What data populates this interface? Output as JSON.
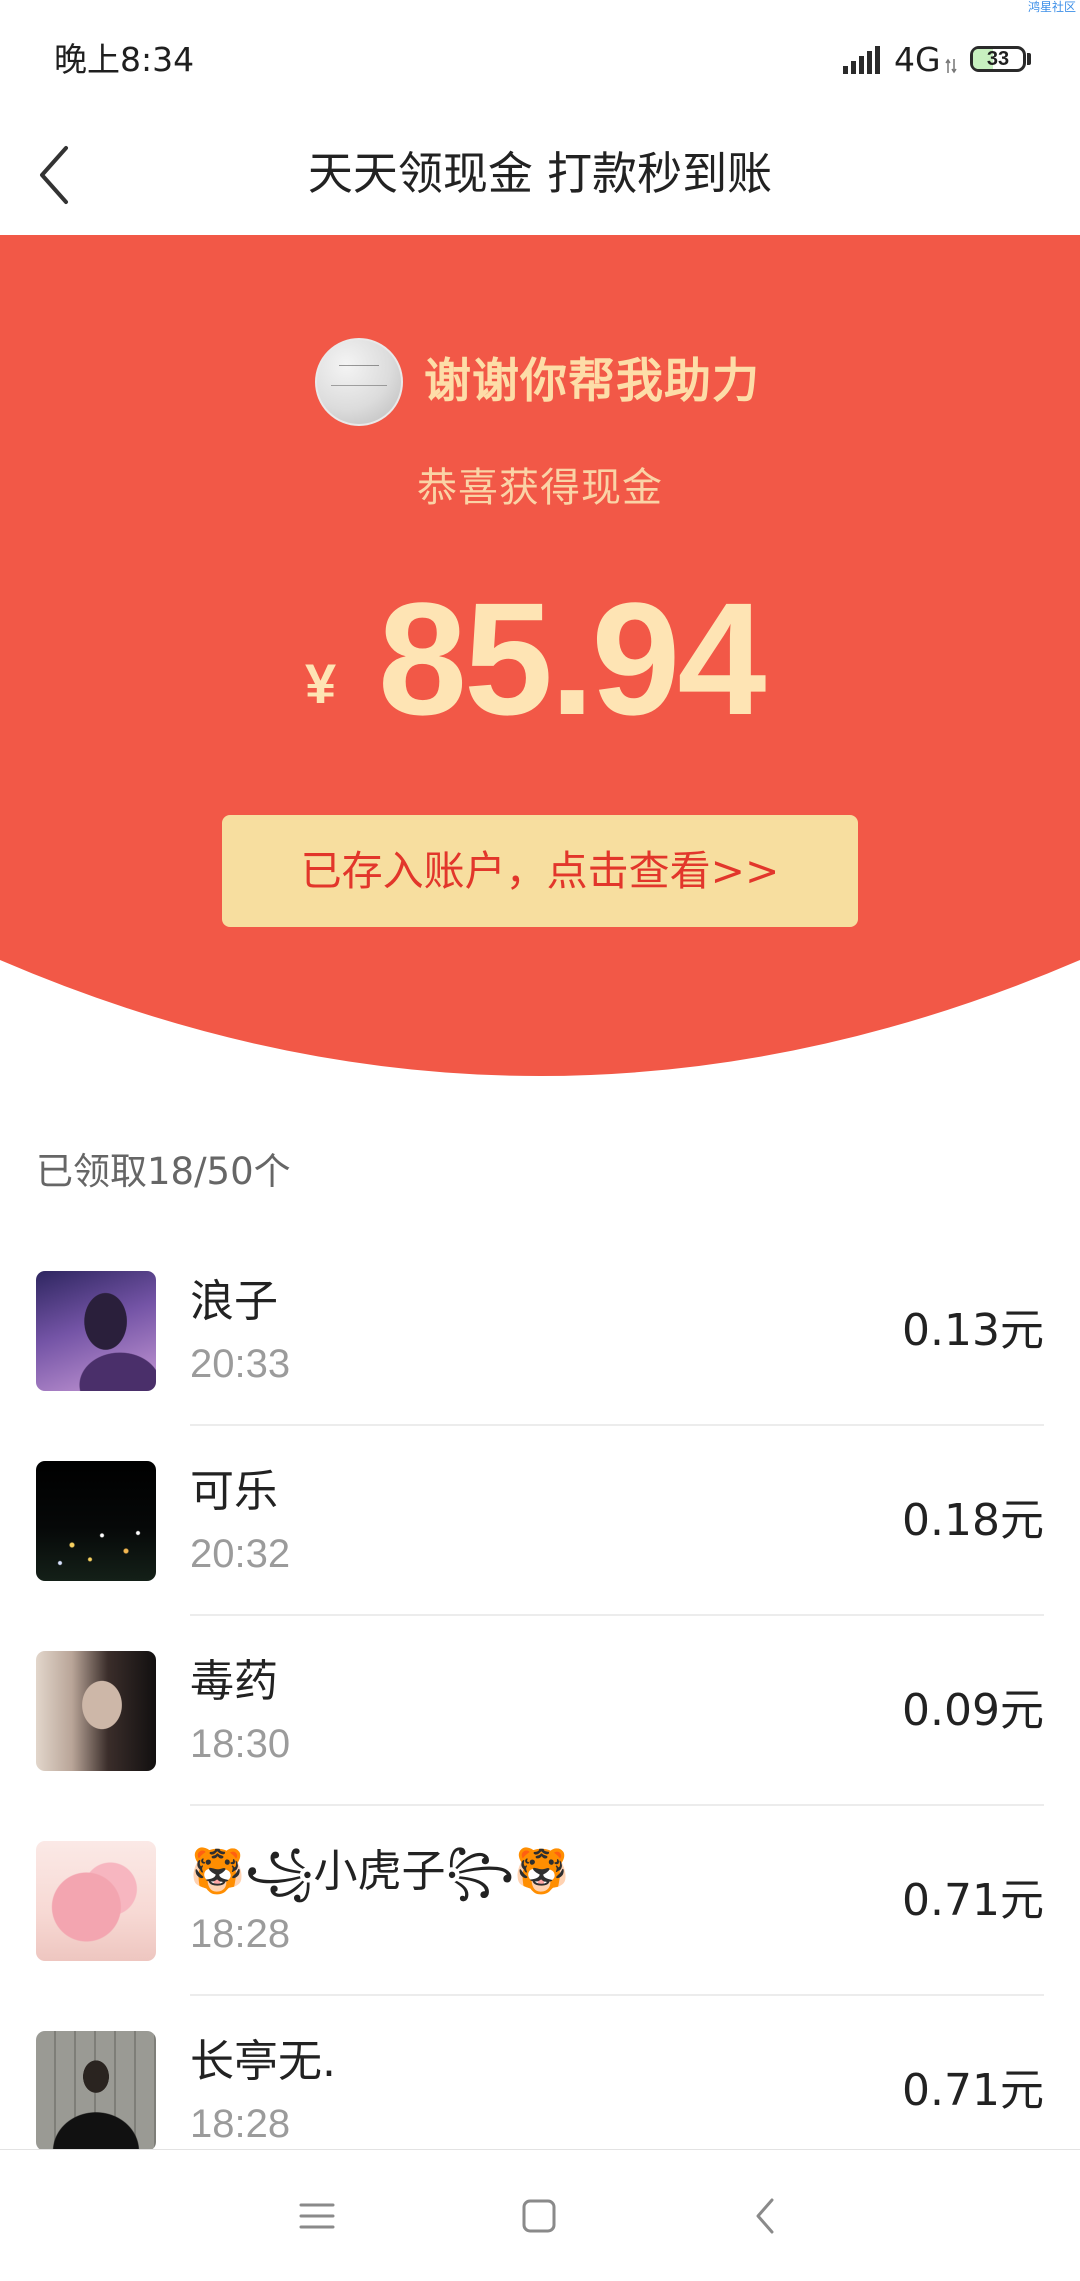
{
  "status_bar": {
    "time": "晚上8:34",
    "network": "4G",
    "battery": "33",
    "watermark": "鸿星社区",
    "icons": [
      "signal-icon",
      "data-activity-icon",
      "battery-icon"
    ]
  },
  "header": {
    "back_icon": "chevron-left-icon",
    "title": "天天领现金 打款秒到账"
  },
  "hero": {
    "avatar_icon": "avatar",
    "thanks_text": "谢谢你帮我助力",
    "subtitle": "恭喜获得现金",
    "currency": "¥",
    "amount": "85.94",
    "button_label": "已存入账户，点击查看>>",
    "colors": {
      "background": "#F25847",
      "accent_text": "#FEE4B4",
      "button_background": "#F7DE9F",
      "button_text": "#E2362B"
    }
  },
  "list": {
    "summary": "已领取18/50个",
    "items": [
      {
        "name": "浪子",
        "time": "20:33",
        "amount": "0.13元"
      },
      {
        "name": "可乐",
        "time": "20:32",
        "amount": "0.18元"
      },
      {
        "name": "毒药",
        "time": "18:30",
        "amount": "0.09元"
      },
      {
        "name": "🐯꧁小虎子꧂🐯",
        "time": "18:28",
        "amount": "0.71元"
      },
      {
        "name": "长亭无.",
        "time": "18:28",
        "amount": "0.71元"
      }
    ]
  },
  "nav_bar": {
    "icons": [
      "menu-icon",
      "home-square-icon",
      "back-icon"
    ]
  }
}
